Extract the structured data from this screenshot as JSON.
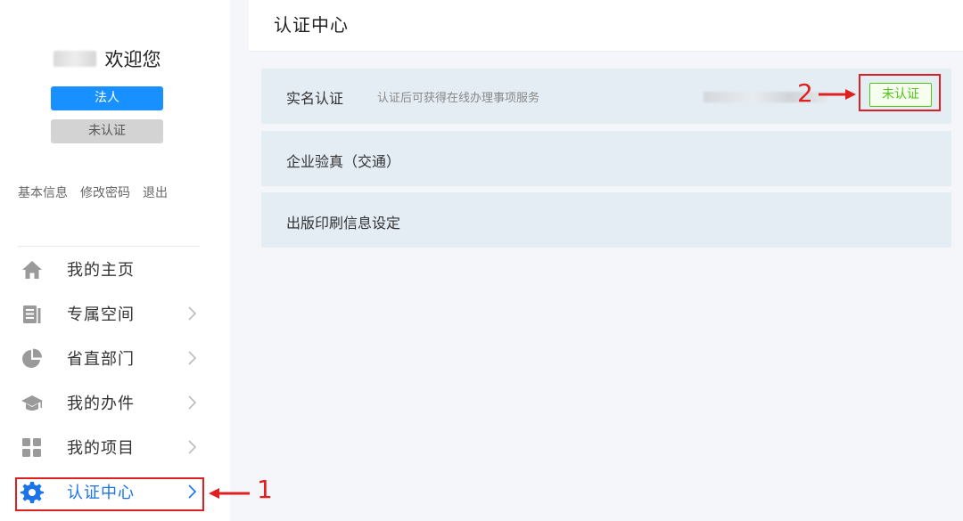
{
  "sidebar": {
    "welcome": "欢迎您",
    "role_badge": "法人",
    "status_badge": "未认证",
    "links": [
      "基本信息",
      "修改密码",
      "退出"
    ],
    "nav": [
      {
        "label": "我的主页",
        "icon": "home-icon",
        "has_chevron": false
      },
      {
        "label": "专属空间",
        "icon": "document-icon",
        "has_chevron": true
      },
      {
        "label": "省直部门",
        "icon": "pie-chart-icon",
        "has_chevron": true
      },
      {
        "label": "我的办件",
        "icon": "graduation-cap-icon",
        "has_chevron": true
      },
      {
        "label": "我的项目",
        "icon": "apps-grid-icon",
        "has_chevron": true
      },
      {
        "label": "认证中心",
        "icon": "gear-icon",
        "has_chevron": true,
        "active": true
      }
    ]
  },
  "annotations": {
    "step1": "1",
    "step2": "2"
  },
  "main": {
    "title": "认证中心",
    "panels": [
      {
        "label": "实名认证",
        "desc": "认证后可获得在线办理事项服务",
        "action": "未认证"
      },
      {
        "label": "企业验真（交通）"
      },
      {
        "label": "出版印刷信息设定"
      }
    ]
  },
  "colors": {
    "accent": "#1890ff",
    "active_text": "#1a73e8",
    "highlight_red": "#e02020",
    "verify_green": "#52c41a",
    "panel_bg": "#e4ecf4"
  }
}
